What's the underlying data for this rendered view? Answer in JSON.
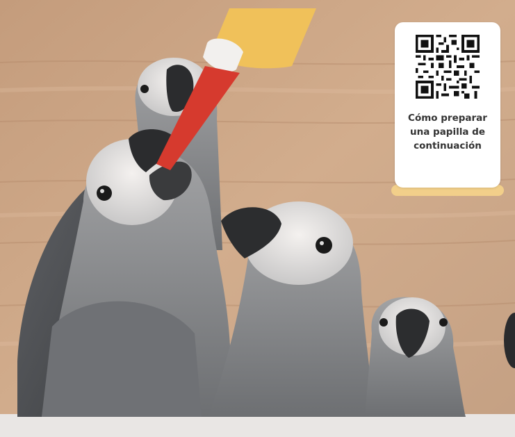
{
  "scene": {
    "description_icon": "parrot-chicks-photo",
    "qr_card": {
      "caption_lines": [
        "Cómo preparar",
        "una papilla de",
        "continuación"
      ]
    }
  },
  "colors": {
    "wall": "#c9a383",
    "feathers": "#7d7f82",
    "feeder_red": "#d63a2e",
    "feeder_yellow": "#f0c15a",
    "card_accent": "#f2cf8a"
  }
}
